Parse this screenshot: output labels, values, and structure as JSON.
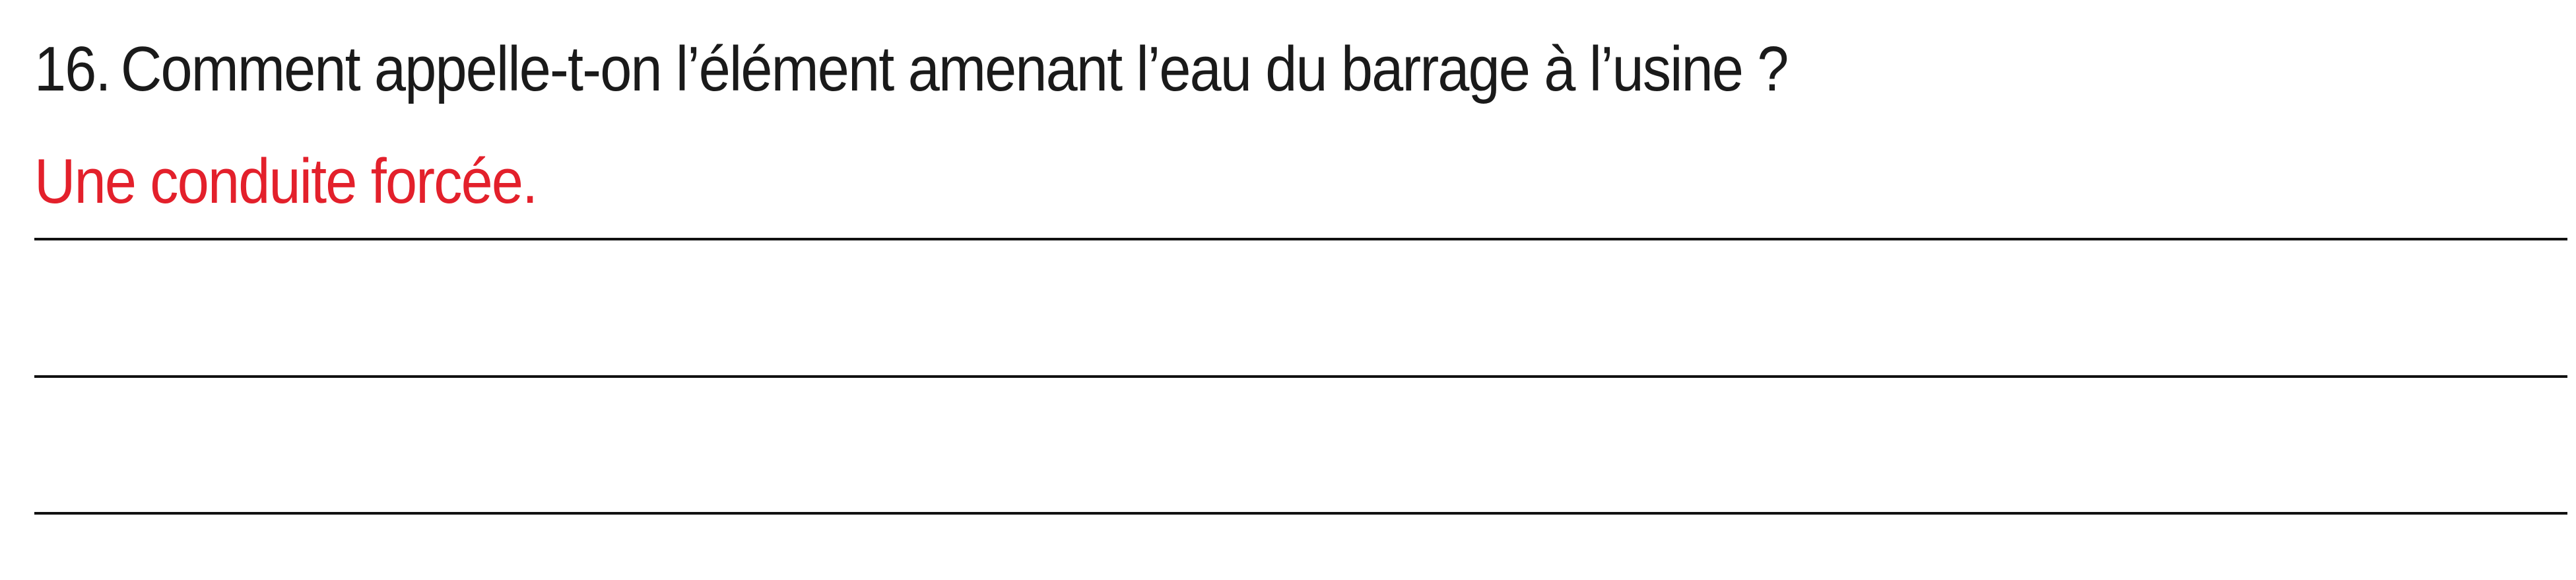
{
  "question": {
    "number": "16.",
    "text": "Comment appelle-t-on l’élément amenant l’eau du barrage à l’usine ?"
  },
  "answer": {
    "text": "Une conduite forcée.",
    "color": "#e3202b"
  },
  "answer_lines_count": 3
}
